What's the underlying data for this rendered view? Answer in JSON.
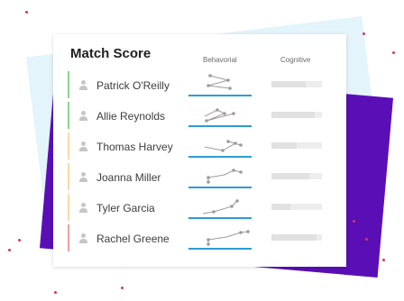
{
  "card": {
    "title": "Match Score",
    "columns": {
      "behavioral": "Behavorial",
      "cognitive": "Cognitive"
    }
  },
  "candidates": [
    {
      "name": "Patrick O'Reilly",
      "accent_color": "#8fd18f",
      "cognitive_score": 0.68
    },
    {
      "name": "Allie Reynolds",
      "accent_color": "#8fd18f",
      "cognitive_score": 0.85
    },
    {
      "name": "Thomas Harvey",
      "accent_color": "#f7d9a8",
      "cognitive_score": 0.5
    },
    {
      "name": "Joanna Miller",
      "accent_color": "#f7d9a8",
      "cognitive_score": 0.75
    },
    {
      "name": "Tyler Garcia",
      "accent_color": "#f7d9a8",
      "cognitive_score": 0.38
    },
    {
      "name": "Rachel Greene",
      "accent_color": "#f2a0a0",
      "cognitive_score": 0.9
    }
  ],
  "colors": {
    "background_purple": "#5a0fb6",
    "background_light": "#e3f4fb",
    "behavioral_baseline": "#2e9bd6"
  }
}
